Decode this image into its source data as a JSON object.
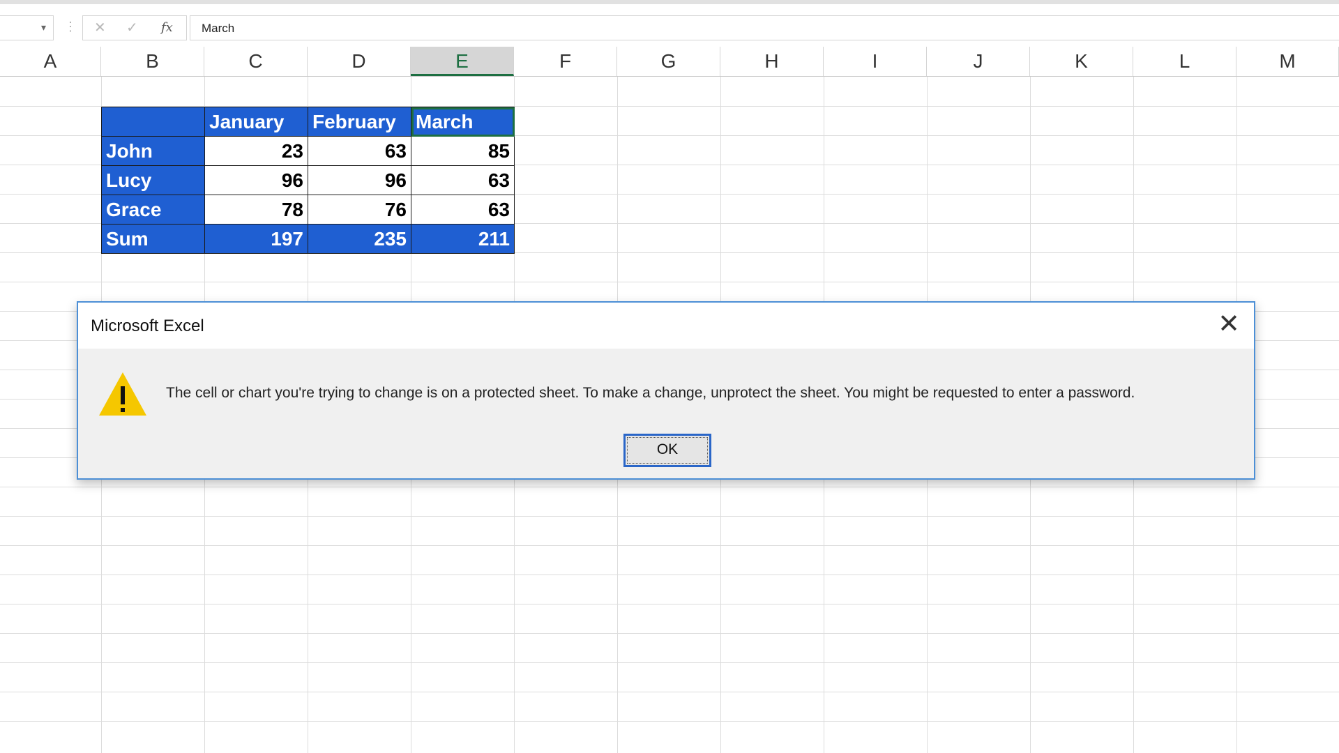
{
  "formula_bar": {
    "name_box_value": "",
    "cancel_icon": "✕",
    "enter_icon": "✓",
    "fx_label": "fx",
    "content": "March"
  },
  "columns": [
    "A",
    "B",
    "C",
    "D",
    "E",
    "F",
    "G",
    "H",
    "I",
    "J",
    "K",
    "L",
    "M"
  ],
  "selected_column": "E",
  "table": {
    "header": [
      "",
      "January",
      "February",
      "March"
    ],
    "rows": [
      {
        "name": "John",
        "values": [
          "23",
          "63",
          "85"
        ]
      },
      {
        "name": "Lucy",
        "values": [
          "96",
          "96",
          "63"
        ]
      },
      {
        "name": "Grace",
        "values": [
          "78",
          "76",
          "63"
        ]
      }
    ],
    "sum": {
      "name": "Sum",
      "values": [
        "197",
        "235",
        "211"
      ]
    }
  },
  "colors": {
    "table_blue": "#1f5fd2",
    "excel_green": "#1d6f42",
    "dialog_border": "#4c8fd6"
  },
  "dialog": {
    "title": "Microsoft Excel",
    "close_icon": "✕",
    "icon": "warning-icon",
    "message": "The cell or chart you're trying to change is on a protected sheet. To make a change, unprotect the sheet. You might be requested to enter a password.",
    "ok_label": "OK"
  }
}
